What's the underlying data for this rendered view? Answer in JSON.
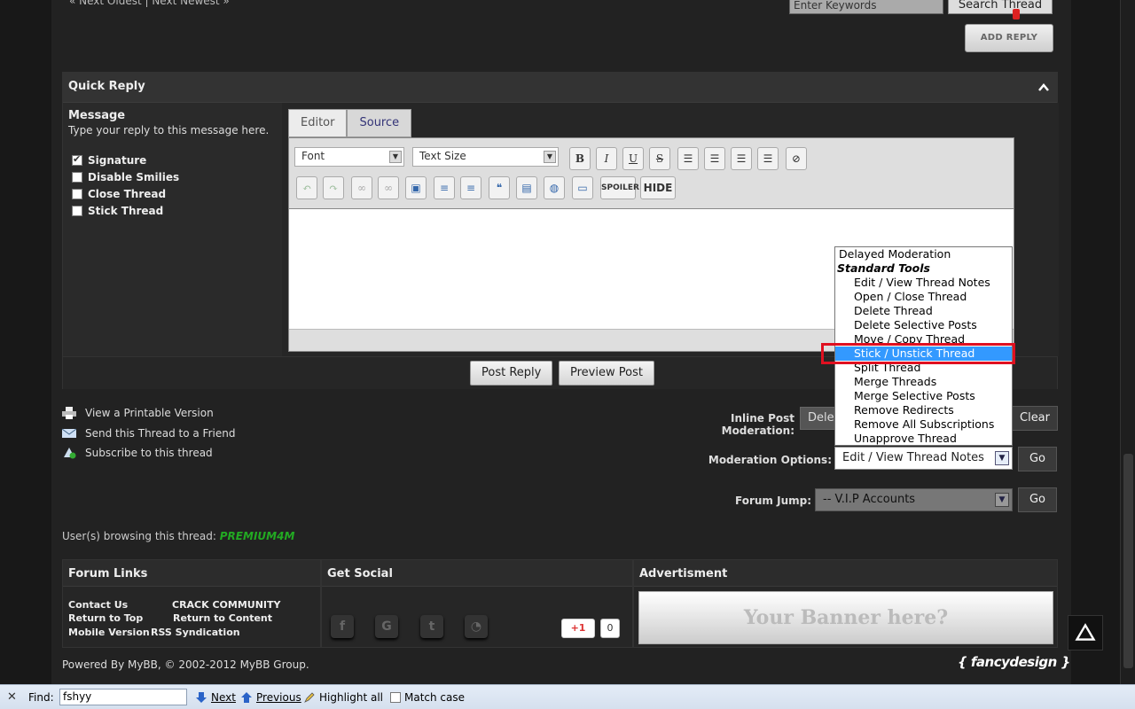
{
  "topbar": {
    "nav_links": "« Next Oldest | Next Newest »",
    "keyword_placeholder": "Enter Keywords",
    "search_label": "Search Thread",
    "add_reply_label": "ADD REPLY"
  },
  "quick_reply": {
    "title": "Quick Reply",
    "message_label": "Message",
    "message_hint": "Type your reply to this message here.",
    "options": [
      {
        "label": "Signature",
        "checked": true
      },
      {
        "label": "Disable Smilies",
        "checked": false
      },
      {
        "label": "Close Thread",
        "checked": false
      },
      {
        "label": "Stick Thread",
        "checked": false
      }
    ],
    "tabs": [
      "Editor",
      "Source"
    ],
    "font_select": "Font",
    "size_select": "Text Size",
    "spoiler_label": "SPOILER",
    "hide_label": "HIDE",
    "post_reply_label": "Post Reply",
    "preview_label": "Preview Post"
  },
  "thread_tools": {
    "printable": "View a Printable Version",
    "send_friend": "Send this Thread to a Friend",
    "subscribe": "Subscribe to this thread"
  },
  "moderation": {
    "inline_label": "Inline Post Moderation:",
    "inline_value": "Delete",
    "clear_label": "Clear",
    "options_label": "Moderation Options:",
    "options_value": "Edit / View Thread Notes",
    "go_label": "Go",
    "dropdown": {
      "first": "Delayed Moderation",
      "group": "Standard Tools",
      "items": [
        "Edit / View Thread Notes",
        "Open / Close Thread",
        "Delete Thread",
        "Delete Selective Posts",
        "Move / Copy Thread",
        "Stick / Unstick Thread",
        "Split Thread",
        "Merge Threads",
        "Merge Selective Posts",
        "Remove Redirects",
        "Remove All Subscriptions",
        "Unapprove Thread"
      ],
      "highlighted": "Stick / Unstick Thread"
    }
  },
  "forum_jump": {
    "label": "Forum Jump:",
    "value": "-- V.I.P Accounts",
    "go_label": "Go"
  },
  "browsing": {
    "label": "User(s) browsing this thread:",
    "user": "PREMIUM4M"
  },
  "footer": {
    "forum_links_title": "Forum Links",
    "links": [
      "Contact Us",
      "CRACK COMMUNITY",
      "Return to Top",
      "Return to Content",
      "Mobile Version",
      "RSS Syndication"
    ],
    "social_title": "Get Social",
    "gplus_label": "+1",
    "gplus_count": "0",
    "ad_title": "Advertisment",
    "banner_text": "Your Banner here?",
    "powered": "Powered By MyBB, © 2002-2012 MyBB Group.",
    "brand": "{ fancydesign }"
  },
  "findbar": {
    "find_label": "Find:",
    "query": "fshyy",
    "next": "Next",
    "previous": "Previous",
    "highlight_all": "Highlight all",
    "match_case": "Match case"
  },
  "colors": {
    "highlight": "#3399ff",
    "annotation_box": "#e01020",
    "username": "#22aa22"
  }
}
